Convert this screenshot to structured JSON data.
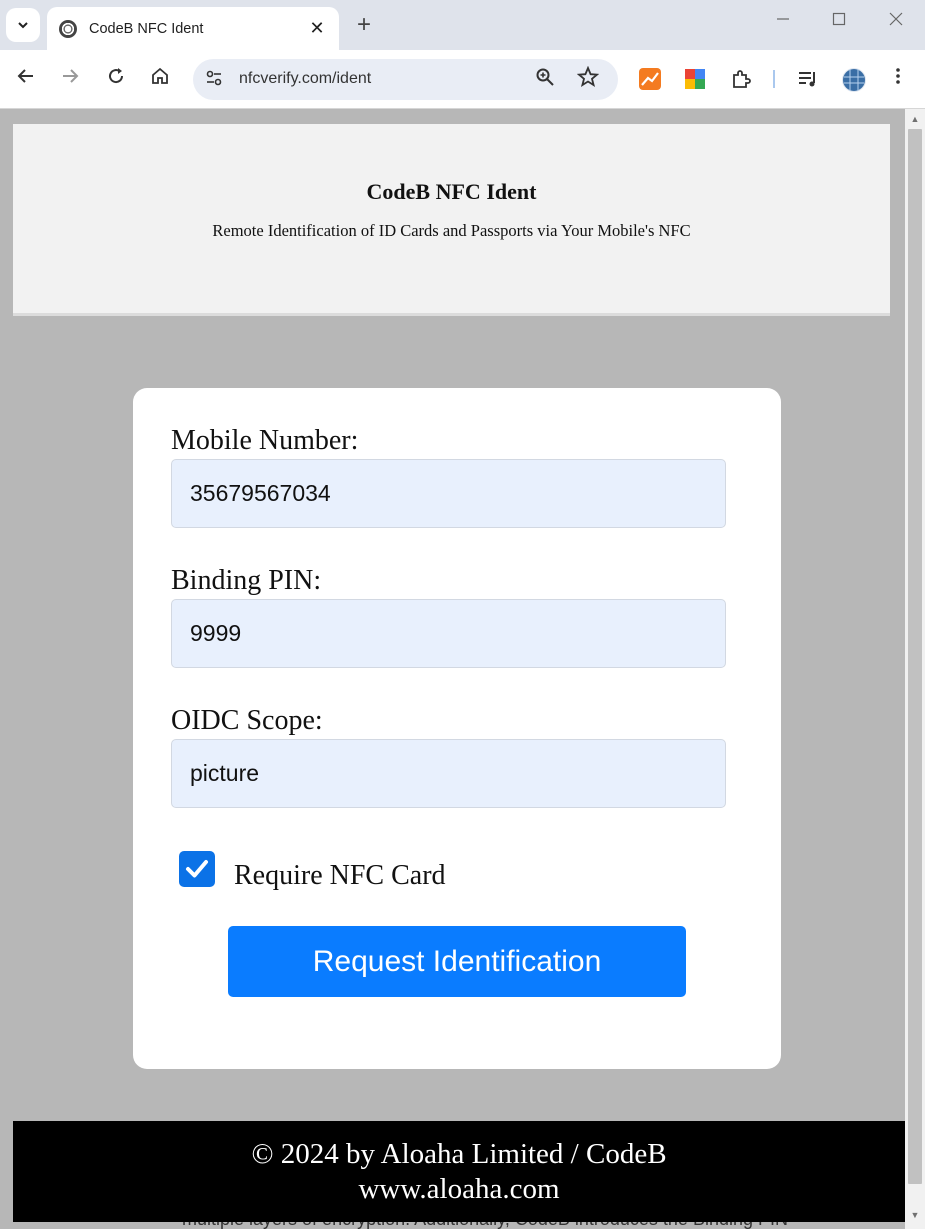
{
  "browser": {
    "tab_title": "CodeB NFC Ident",
    "new_tab_symbol": "+",
    "tab_close_symbol": "✕",
    "url": "nfcverify.com/ident"
  },
  "header": {
    "title": "CodeB NFC Ident",
    "subtitle": "Remote Identification of ID Cards and Passports via Your Mobile's NFC"
  },
  "form": {
    "mobile_label": "Mobile Number:",
    "mobile_value": "35679567034",
    "pin_label": "Binding PIN:",
    "pin_value": "9999",
    "scope_label": "OIDC Scope:",
    "scope_value": "picture",
    "require_nfc_label": "Require NFC Card",
    "require_nfc_checked": true,
    "submit_label": "Request Identification"
  },
  "peek_text": "multiple layers of encryption. Additionally, CodeB introduces the Binding PIN",
  "footer": {
    "line1": "© 2024 by Aloaha Limited / CodeB",
    "line2": "www.aloaha.com"
  },
  "colors": {
    "accent": "#0a7cff",
    "checkbox": "#0b72e7",
    "page_background": "#b7b7b7",
    "input_background": "#e8f0fd"
  }
}
